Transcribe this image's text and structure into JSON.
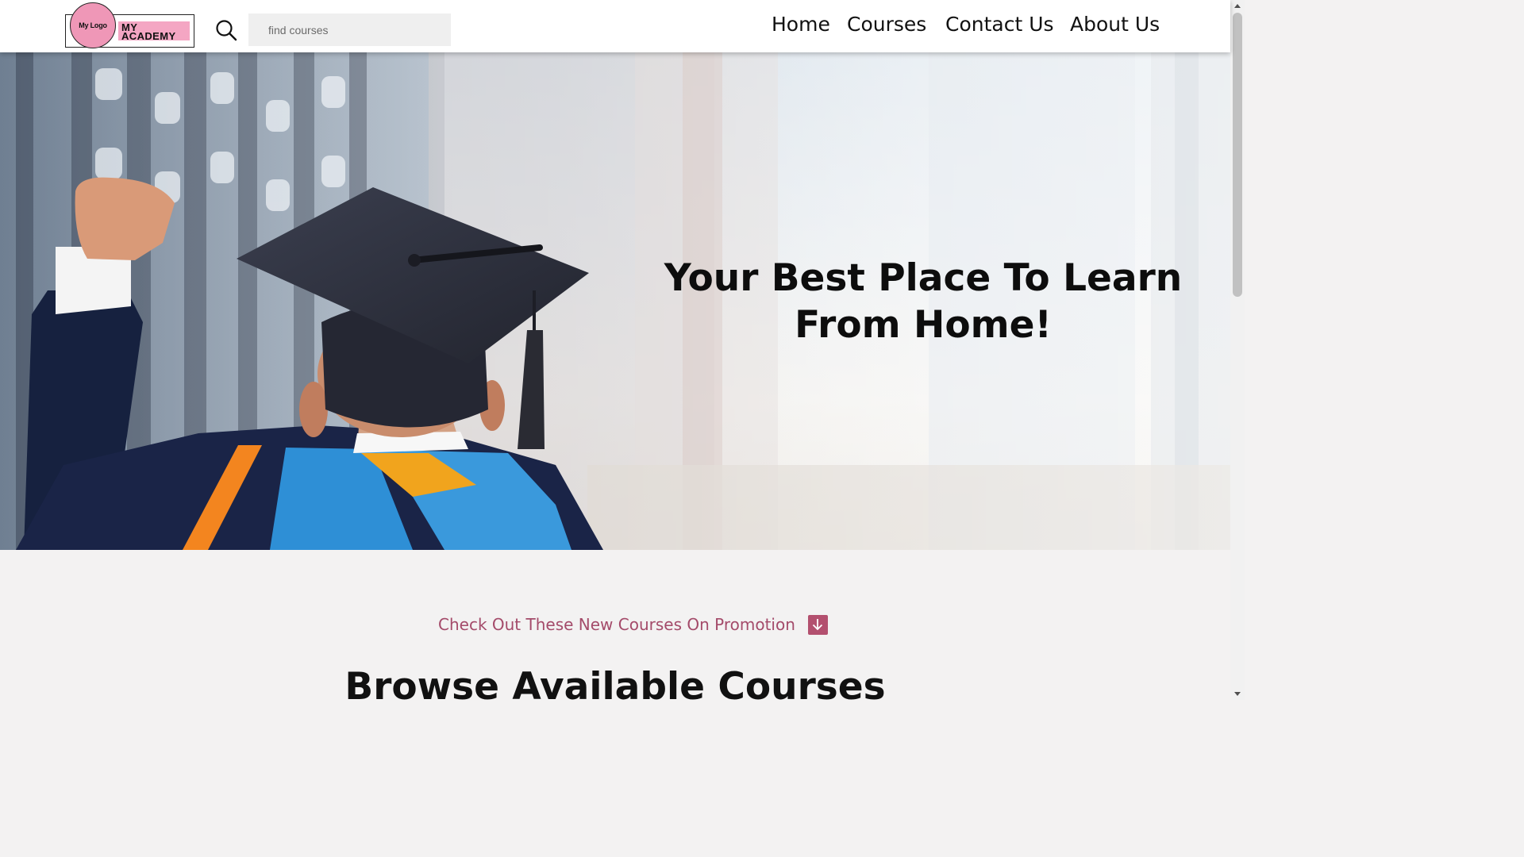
{
  "header": {
    "logo": {
      "circle_text": "My Logo",
      "wordmark": "MY\nACADEMY"
    },
    "search": {
      "placeholder": "find courses",
      "icon": "search-icon"
    },
    "nav": [
      {
        "label": "Home"
      },
      {
        "label": "Courses"
      },
      {
        "label": "Contact Us"
      },
      {
        "label": "About Us"
      }
    ]
  },
  "hero": {
    "title": "Your Best Place To Learn From Home!"
  },
  "promo": {
    "text": "Check Out These New Courses On Promotion",
    "icon": "arrow-down-icon"
  },
  "section": {
    "title": "Browse Available Courses"
  },
  "colors": {
    "accent": "#a44b6a",
    "accent_button": "#b3506f",
    "logo_pink": "#ef97b7",
    "page_background": "#f3f2f2"
  }
}
